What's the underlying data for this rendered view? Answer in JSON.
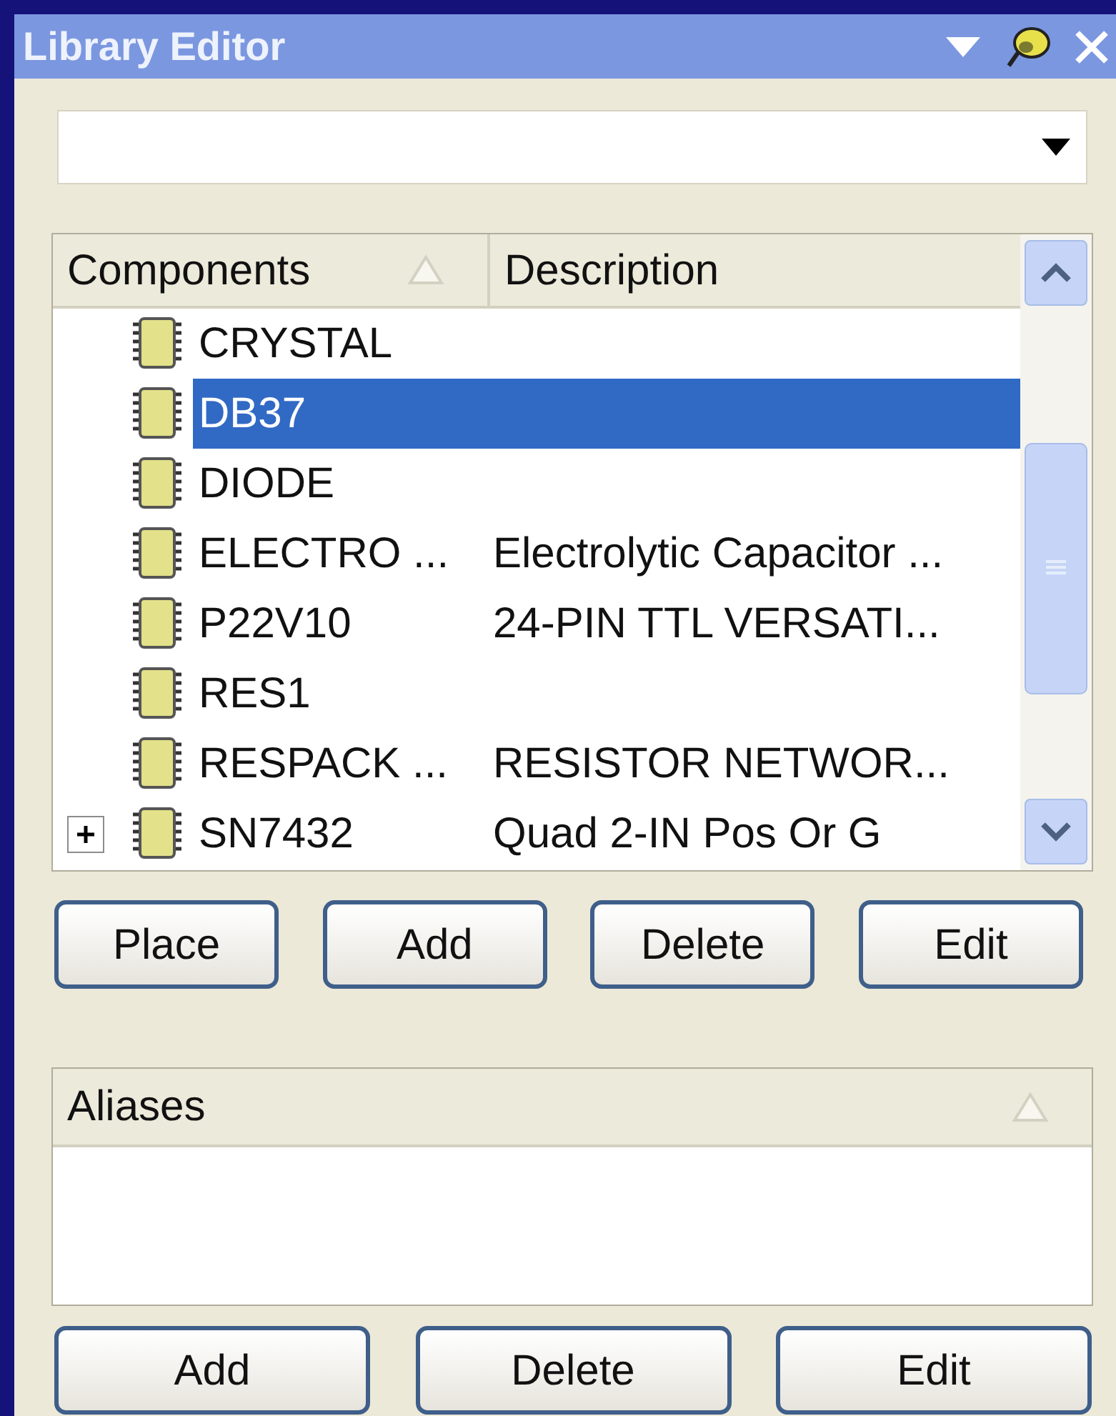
{
  "panel": {
    "title": "Library Editor"
  },
  "components": {
    "columns": [
      {
        "label": "Components",
        "sorted": true
      },
      {
        "label": "Description",
        "sorted": false
      }
    ],
    "rows": [
      {
        "name": "CRYSTAL",
        "expandable": false,
        "selected": false
      },
      {
        "name": "DB37",
        "expandable": false,
        "selected": true
      },
      {
        "name": "DIODE",
        "expandable": false,
        "selected": false
      },
      {
        "name": "ELECTRO ...",
        "description": "Electrolytic Capacitor ...",
        "expandable": false,
        "selected": false
      },
      {
        "name": "P22V10",
        "description": "24-PIN TTL VERSATI...",
        "expandable": false,
        "selected": false
      },
      {
        "name": "RES1",
        "expandable": false,
        "selected": false
      },
      {
        "name": "RESPACK ...",
        "description": "RESISTOR NETWOR...",
        "expandable": false,
        "selected": false
      },
      {
        "name": "SN7432",
        "description": "Quad 2-IN Pos Or G",
        "expandable": true,
        "selected": false
      }
    ]
  },
  "component_buttons": [
    "Place",
    "Add",
    "Delete",
    "Edit"
  ],
  "aliases": {
    "columns": [
      {
        "label": "Aliases",
        "sorted": true
      }
    ]
  },
  "alias_buttons": [
    "Add",
    "Delete",
    "Edit"
  ]
}
